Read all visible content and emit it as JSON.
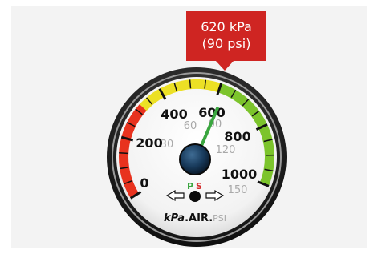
{
  "callout": {
    "line1": "620 kPa",
    "line2": "(90 psi)",
    "color": "#cf2522"
  },
  "gauge": {
    "kpa_labels": [
      "0",
      "200",
      "400",
      "600",
      "800",
      "1000"
    ],
    "psi_labels": [
      "30",
      "60",
      "90",
      "120",
      "150"
    ],
    "reading_kpa": 620,
    "reading_psi": 90,
    "units": {
      "kpa": "kPa",
      "separator": ".",
      "air": "AIR",
      "psi": "PSI"
    },
    "ps_label": {
      "p": "P",
      "s": "S"
    },
    "zone_colors": {
      "low": "#e8321e",
      "mid": "#ece025",
      "high": "#7cc42c"
    },
    "needle_color": "#3aa63f"
  }
}
